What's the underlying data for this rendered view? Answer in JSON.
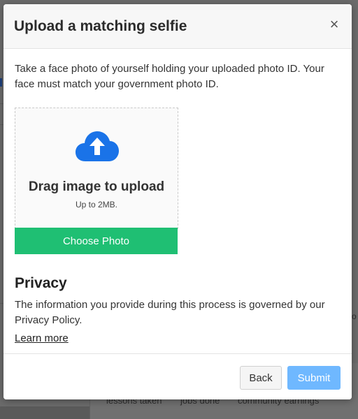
{
  "background": {
    "stats": [
      "lessons taken",
      "jobs done",
      "community earnings"
    ],
    "right_fragment": "o"
  },
  "modal": {
    "title": "Upload a matching selfie",
    "close_glyph": "×",
    "intro": "Take a face photo of yourself holding your uploaded photo ID. Your face must match your government photo ID.",
    "dropzone": {
      "icon": "cloud-upload-icon",
      "title": "Drag image to upload",
      "subtitle": "Up to 2MB."
    },
    "choose_button": "Choose Photo",
    "privacy": {
      "title": "Privacy",
      "text": "The information you provide during this process is governed by our Privacy Policy.",
      "learn_more": "Learn more"
    },
    "footer": {
      "back": "Back",
      "submit": "Submit"
    }
  },
  "colors": {
    "primary_green": "#1fbf73",
    "icon_blue": "#1a73e8",
    "submit_blue": "#6fb8ff"
  }
}
